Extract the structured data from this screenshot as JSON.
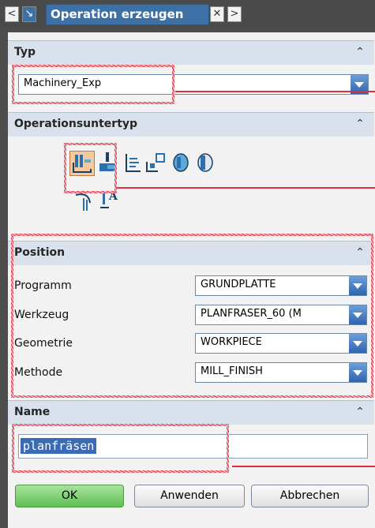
{
  "window": {
    "title": "Operation erzeugen"
  },
  "sections": {
    "typ": {
      "label": "Typ",
      "value": "Machinery_Exp"
    },
    "subtype": {
      "label": "Operationsuntertyp"
    },
    "position": {
      "label": "Position",
      "rows": [
        {
          "label": "Programm",
          "value": "GRUNDPLATTE"
        },
        {
          "label": "Werkzeug",
          "value": "PLANFRÄSER_60 (M"
        },
        {
          "label": "Geometrie",
          "value": "WORKPIECE"
        },
        {
          "label": "Methode",
          "value": "MILL_FINISH"
        }
      ]
    },
    "name": {
      "label": "Name",
      "value": "planfräsen"
    }
  },
  "buttons": {
    "ok": "OK",
    "apply": "Anwenden",
    "cancel": "Abbrechen"
  },
  "icons": {
    "titlebar": [
      "back-arrow-icon",
      "pin-icon",
      "close-icon",
      "forward-arrow-icon"
    ],
    "collapse": "chevron-up-icon",
    "subtypes": [
      "face-milling-area-icon",
      "face-milling-icon",
      "face-milling-manual-icon",
      "planar-mill-icon",
      "planar-profile-icon",
      "cleanup-corners-icon",
      "finish-walls-icon",
      "planar-text-icon"
    ]
  },
  "colors": {
    "header_bg": "#d9e2ec",
    "title_bg": "#3d71a6",
    "ok_green": "#5fbf54",
    "highlight_red": "#e04050"
  }
}
